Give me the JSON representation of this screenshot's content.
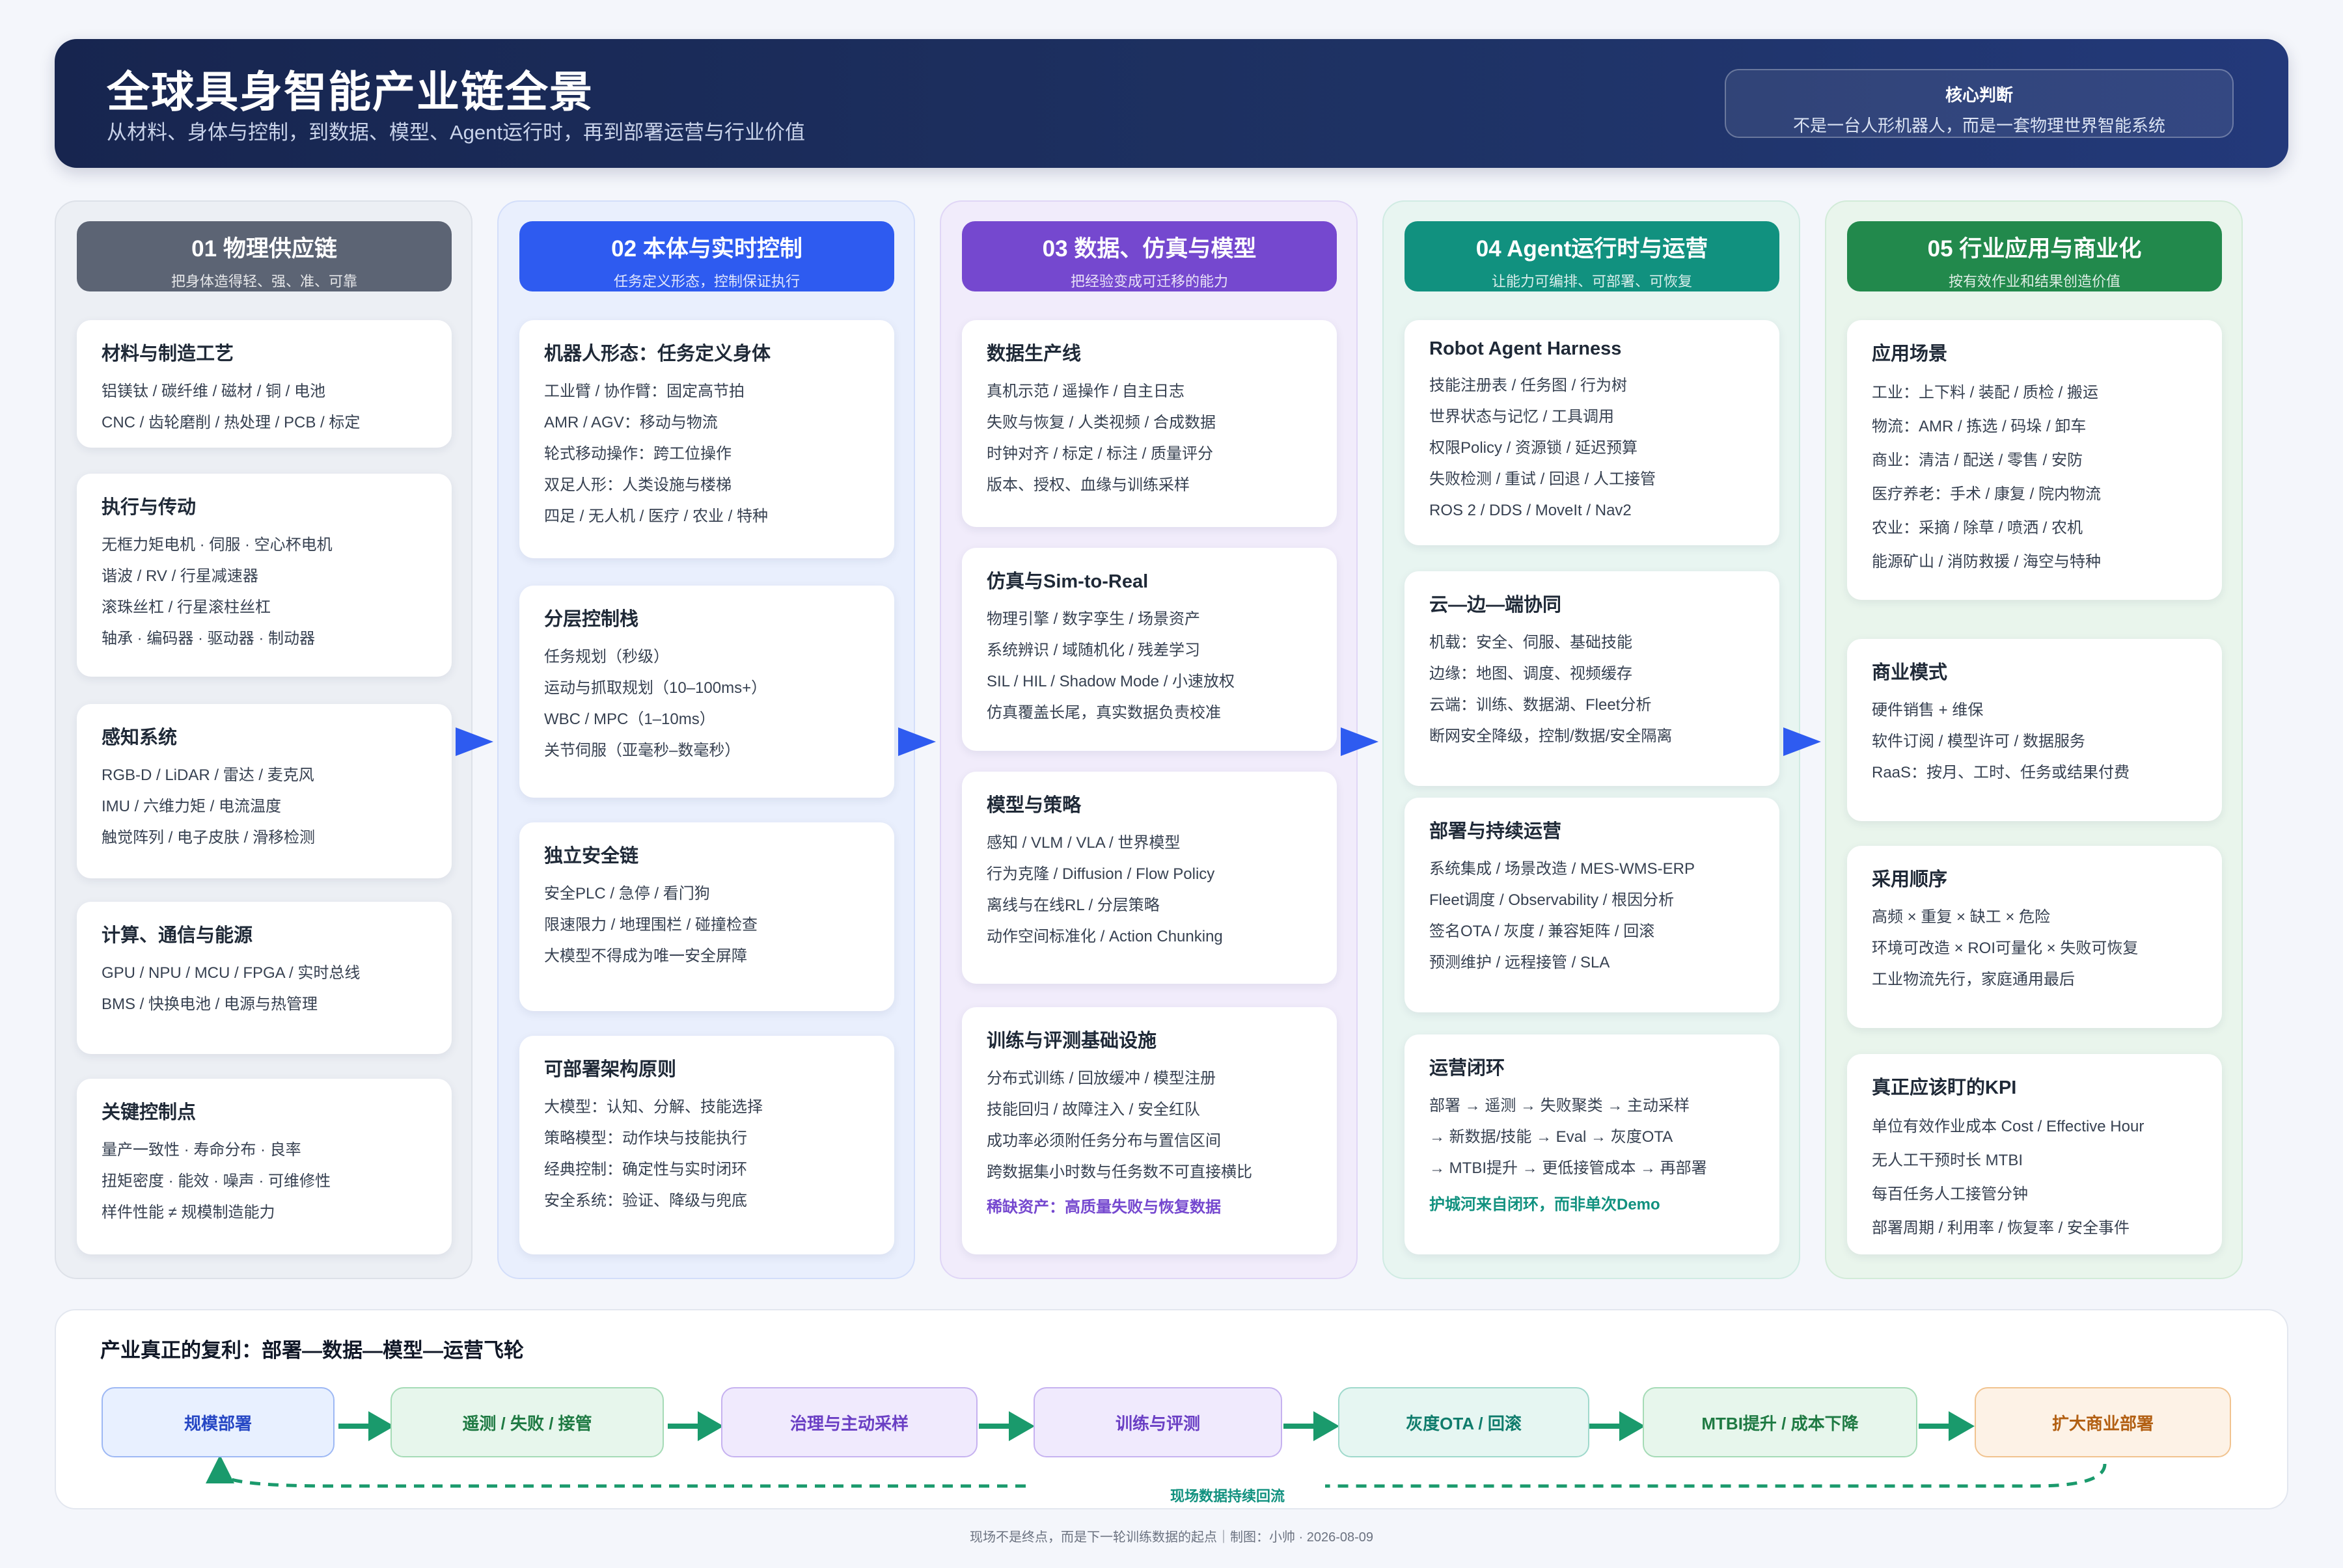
{
  "header": {
    "title": "全球具身智能产业链全景",
    "subtitle": "从材料、身体与控制，到数据、模型、Agent运行时，再到部署运营与行业价值",
    "judge_title": "核心判断",
    "judge_text": "不是一台人形机器人，而是一套物理世界智能系统"
  },
  "columns": [
    {
      "title": "01 物理供应链",
      "subtitle": "把身体造得轻、强、准、可靠",
      "cards": [
        {
          "title": "材料与制造工艺",
          "lines": [
            "铝镁钛 / 碳纤维 / 磁材 / 铜 / 电池",
            "CNC / 齿轮磨削 / 热处理 / PCB / 标定"
          ]
        },
        {
          "title": "执行与传动",
          "lines": [
            "无框力矩电机 · 伺服 · 空心杯电机",
            "谐波 / RV / 行星减速器",
            "滚珠丝杠 / 行星滚柱丝杠",
            "轴承 · 编码器 · 驱动器 · 制动器"
          ]
        },
        {
          "title": "感知系统",
          "lines": [
            "RGB-D / LiDAR / 雷达 / 麦克风",
            "IMU / 六维力矩 / 电流温度",
            "触觉阵列 / 电子皮肤 / 滑移检测"
          ]
        },
        {
          "title": "计算、通信与能源",
          "lines": [
            "GPU / NPU / MCU / FPGA / 实时总线",
            "BMS / 快换电池 / 电源与热管理"
          ]
        },
        {
          "title": "关键控制点",
          "lines": [
            "量产一致性 · 寿命分布 · 良率",
            "扭矩密度 · 能效 · 噪声 · 可维修性",
            "样件性能 ≠ 规模制造能力"
          ]
        }
      ]
    },
    {
      "title": "02 本体与实时控制",
      "subtitle": "任务定义形态，控制保证执行",
      "cards": [
        {
          "title": "机器人形态：任务定义身体",
          "lines": [
            "工业臂 / 协作臂：固定高节拍",
            "AMR / AGV：移动与物流",
            "轮式移动操作：跨工位操作",
            "双足人形：人类设施与楼梯",
            "四足 / 无人机 / 医疗 / 农业 / 特种"
          ]
        },
        {
          "title": "分层控制栈",
          "lines": [
            "任务规划（秒级）",
            "运动与抓取规划（10–100ms+）",
            "WBC / MPC（1–10ms）",
            "关节伺服（亚毫秒–数毫秒）"
          ]
        },
        {
          "title": "独立安全链",
          "lines": [
            "安全PLC / 急停 / 看门狗",
            "限速限力 / 地理围栏 / 碰撞检查",
            "大模型不得成为唯一安全屏障"
          ]
        },
        {
          "title": "可部署架构原则",
          "lines": [
            "大模型：认知、分解、技能选择",
            "策略模型：动作块与技能执行",
            "经典控制：确定性与实时闭环",
            "安全系统：验证、降级与兜底"
          ]
        }
      ]
    },
    {
      "title": "03 数据、仿真与模型",
      "subtitle": "把经验变成可迁移的能力",
      "cards": [
        {
          "title": "数据生产线",
          "lines": [
            "真机示范 / 遥操作 / 自主日志",
            "失败与恢复 / 人类视频 / 合成数据",
            "时钟对齐 / 标定 / 标注 / 质量评分",
            "版本、授权、血缘与训练采样"
          ]
        },
        {
          "title": "仿真与Sim-to-Real",
          "lines": [
            "物理引擎 / 数字孪生 / 场景资产",
            "系统辨识 / 域随机化 / 残差学习",
            "SIL / HIL / Shadow Mode / 小速放权",
            "仿真覆盖长尾，真实数据负责校准"
          ]
        },
        {
          "title": "模型与策略",
          "lines": [
            "感知 / VLM / VLA / 世界模型",
            "行为克隆 / Diffusion / Flow Policy",
            "离线与在线RL / 分层策略",
            "动作空间标准化 / Action Chunking"
          ]
        },
        {
          "title": "训练与评测基础设施",
          "lines": [
            "分布式训练 / 回放缓冲 / 模型注册",
            "技能回归 / 故障注入 / 安全红队",
            "成功率必须附任务分布与置信区间",
            "跨数据集小时数与任务数不可直接横比"
          ],
          "highlight": "稀缺资产：高质量失败与恢复数据"
        }
      ]
    },
    {
      "title": "04 Agent运行时与运营",
      "subtitle": "让能力可编排、可部署、可恢复",
      "cards": [
        {
          "title": "Robot Agent Harness",
          "lines": [
            "技能注册表 / 任务图 / 行为树",
            "世界状态与记忆 / 工具调用",
            "权限Policy / 资源锁 / 延迟预算",
            "失败检测 / 重试 / 回退 / 人工接管",
            "ROS 2 / DDS / MoveIt / Nav2"
          ]
        },
        {
          "title": "云—边—端协同",
          "lines": [
            "机载：安全、伺服、基础技能",
            "边缘：地图、调度、视频缓存",
            "云端：训练、数据湖、Fleet分析",
            "断网安全降级，控制/数据/安全隔离"
          ]
        },
        {
          "title": "部署与持续运营",
          "lines": [
            "系统集成 / 场景改造 / MES-WMS-ERP",
            "Fleet调度 / Observability / 根因分析",
            "签名OTA / 灰度 / 兼容矩阵 / 回滚",
            "预测维护 / 远程接管 / SLA"
          ]
        },
        {
          "title": "运营闭环",
          "lines": [
            "部署 → 遥测 → 失败聚类 → 主动采样",
            "→ 新数据/技能 → Eval → 灰度OTA",
            "→ MTBI提升 → 更低接管成本 → 再部署"
          ],
          "highlight": "护城河来自闭环，而非单次Demo"
        }
      ]
    },
    {
      "title": "05 行业应用与商业化",
      "subtitle": "按有效作业和结果创造价值",
      "cards": [
        {
          "title": "应用场景",
          "lines": [
            "工业：上下料 / 装配 / 质检 / 搬运",
            "物流：AMR / 拣选 / 码垛 / 卸车",
            "商业：清洁 / 配送 / 零售 / 安防",
            "医疗养老：手术 / 康复 / 院内物流",
            "农业：采摘 / 除草 / 喷洒 / 农机",
            "能源矿山 / 消防救援 / 海空与特种"
          ]
        },
        {
          "title": "商业模式",
          "lines": [
            "硬件销售 + 维保",
            "软件订阅 / 模型许可 / 数据服务",
            "RaaS：按月、工时、任务或结果付费"
          ]
        },
        {
          "title": "采用顺序",
          "lines": [
            "高频 × 重复 × 缺工 × 危险",
            "环境可改造 × ROI可量化 × 失败可恢复",
            "工业物流先行，家庭通用最后"
          ]
        },
        {
          "title": "真正应该盯的KPI",
          "lines": [
            "单位有效作业成本 Cost / Effective Hour",
            "无人工干预时长 MTBI",
            "每百任务人工接管分钟",
            "部署周期 / 利用率 / 恢复率 / 安全事件"
          ]
        }
      ]
    }
  ],
  "flywheel": {
    "title": "产业真正的复利：部署—数据—模型—运营飞轮",
    "nodes": [
      "规模部署",
      "遥测 / 失败 / 接管",
      "治理与主动采样",
      "训练与评测",
      "灰度OTA / 回滚",
      "MTBI提升 / 成本下降",
      "扩大商业部署"
    ],
    "loop_label": "现场数据持续回流"
  },
  "footer": "现场不是终点，而是下一轮训练数据的起点｜制图：小帅 · 2026-08-09",
  "colors": {
    "header_bg": "#1e3264",
    "col1": "#5c6474",
    "col2": "#2e5bf0",
    "col3": "#7548cf",
    "col4": "#11917f",
    "col5": "#22894c"
  }
}
